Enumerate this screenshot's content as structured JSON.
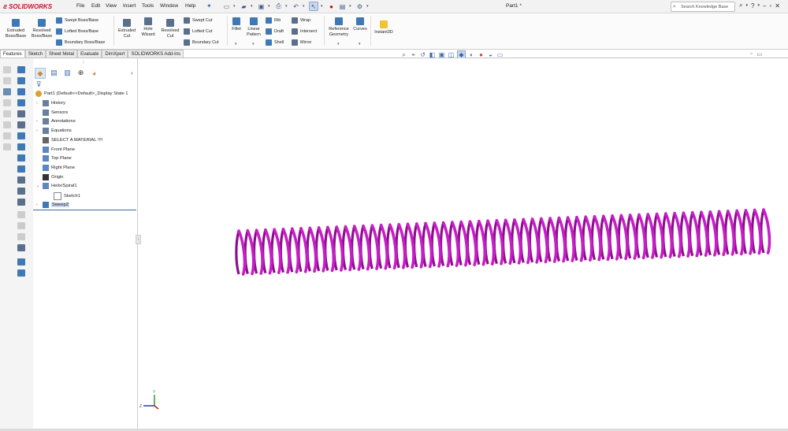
{
  "app": {
    "brand": "SOLIDWORKS",
    "document_title": "Part1 *"
  },
  "menu": [
    "File",
    "Edit",
    "View",
    "Insert",
    "Tools",
    "Window",
    "Help"
  ],
  "search": {
    "placeholder": "Search Knowledge Base"
  },
  "window_controls": {
    "help": "?"
  },
  "ribbon": {
    "extruded_boss": "Extruded\nBoss/Base",
    "revolved_boss": "Revolved\nBoss/Base",
    "swept_boss": "Swept Boss/Base",
    "lofted_boss": "Lofted Boss/Base",
    "boundary_boss": "Boundary Boss/Base",
    "extruded_cut": "Extruded\nCut",
    "hole_wizard": "Hole\nWizard",
    "revolved_cut": "Revolved\nCut",
    "swept_cut": "Swept Cut",
    "lofted_cut": "Lofted Cut",
    "boundary_cut": "Boundary Cut",
    "fillet": "Fillet",
    "linear_pattern": "Linear\nPattern",
    "rib": "Rib",
    "draft": "Draft",
    "shell": "Shell",
    "wrap": "Wrap",
    "intersect": "Intersect",
    "mirror": "Mirror",
    "reference_geometry": "Reference\nGeometry",
    "curves": "Curves",
    "instant3d": "Instant3D"
  },
  "tabs": [
    "Features",
    "Sketch",
    "Sheet Metal",
    "Evaluate",
    "DimXpert",
    "SOLIDWORKS Add-Ins"
  ],
  "active_tab": "Features",
  "tree": {
    "root": "Part1  (Default<<Default>_Display State 1",
    "items": [
      {
        "label": "History",
        "icon": "history-icon",
        "expandable": true
      },
      {
        "label": "Sensors",
        "icon": "sensors-icon",
        "expandable": false
      },
      {
        "label": "Annotations",
        "icon": "annotations-icon",
        "expandable": true
      },
      {
        "label": "Equations",
        "icon": "equations-icon",
        "expandable": true
      },
      {
        "label": "SELECT A MATERIAL !!!!",
        "icon": "material-icon",
        "expandable": false
      },
      {
        "label": "Front Plane",
        "icon": "plane-icon",
        "expandable": false
      },
      {
        "label": "Top Plane",
        "icon": "plane-icon",
        "expandable": false
      },
      {
        "label": "Right Plane",
        "icon": "plane-icon",
        "expandable": false
      },
      {
        "label": "Origin",
        "icon": "origin-icon",
        "expandable": false
      },
      {
        "label": "Helix/Spiral1",
        "icon": "helix-icon",
        "expandable": true,
        "expanded": true
      },
      {
        "label": "Sketch1",
        "icon": "sketch-icon",
        "expandable": false,
        "child": true
      },
      {
        "label": "Sweep2",
        "icon": "sweep-icon",
        "expandable": true,
        "selected": true
      }
    ]
  },
  "triad": {
    "y": "Y",
    "z": "Z"
  },
  "colors": {
    "spring": "#c81ec8",
    "spring_dark": "#8a0f8a",
    "selection": "#3a6aa5",
    "brand_red": "#c8102e"
  }
}
